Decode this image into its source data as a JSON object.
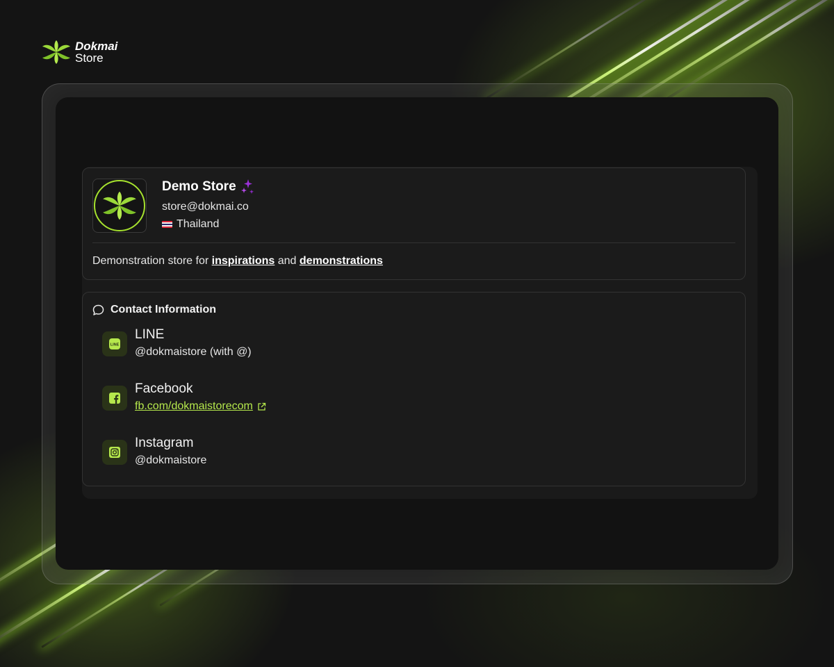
{
  "brand": {
    "line1": "Dokmai",
    "line2": "Store"
  },
  "store": {
    "name": "Demo Store",
    "email": "store@dokmai.co",
    "country": "Thailand",
    "description_prefix": "Demonstration store for ",
    "description_link1": "inspirations",
    "description_mid": " and ",
    "description_link2": "demonstrations",
    "accent_color": "#a6e22e"
  },
  "contact": {
    "heading": "Contact Information",
    "items": [
      {
        "title": "LINE",
        "value": "@dokmaistore (with @)",
        "icon": "line-icon"
      },
      {
        "title": "Facebook",
        "value": "fb.com/dokmaistorecom",
        "icon": "facebook-icon"
      },
      {
        "title": "Instagram",
        "value": "@dokmaistore",
        "icon": "instagram-icon"
      }
    ]
  },
  "colors": {
    "background": "#141414",
    "accent": "#a6e22e",
    "link": "#b5e84c",
    "sparkle": "#9b30d9"
  }
}
